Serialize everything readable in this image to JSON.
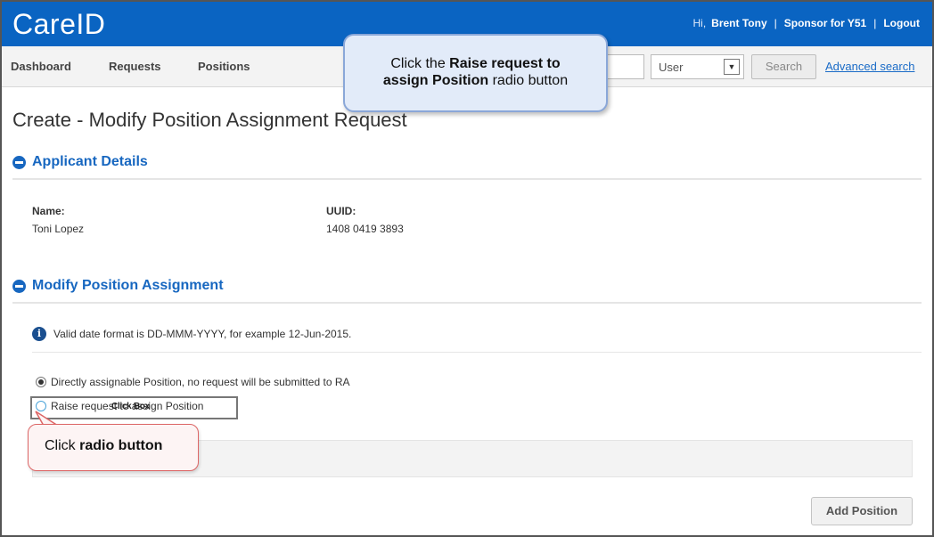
{
  "header": {
    "app_title": "CareID",
    "greeting": "Hi,",
    "user_name": "Brent Tony",
    "separator": "|",
    "role": "Sponsor for Y51",
    "logout_label": "Logout"
  },
  "nav": {
    "items": [
      {
        "label": "Dashboard"
      },
      {
        "label": "Requests"
      },
      {
        "label": "Positions"
      }
    ],
    "search_type_selected": "User",
    "search_button_label": "Search",
    "advanced_search_label": "Advanced search"
  },
  "callout_top": {
    "line1_pre": "Click the ",
    "line1_bold": "Raise request to",
    "line2_bold": "assign Position",
    "line2_post": " radio button"
  },
  "page": {
    "title": "Create - Modify Position Assignment Request"
  },
  "applicant_details": {
    "heading": "Applicant Details",
    "name_label": "Name:",
    "name_value": "Toni Lopez",
    "uuid_label": "UUID:",
    "uuid_value": "1408 0419 3893"
  },
  "modify_assignment": {
    "heading": "Modify Position Assignment",
    "info_text": "Valid date format is DD-MMM-YYYY, for example 12-Jun-2015.",
    "option_direct": "Directly assignable Position, no request will be submitted to RA",
    "option_raise": "Raise request to assign Position",
    "click_box_label": "Click Box",
    "add_button_label": "Add Position"
  },
  "callout_bottom": {
    "pre": "Click ",
    "bold": "radio button"
  },
  "colors": {
    "header_blue": "#0a64c2",
    "section_blue": "#1767c0",
    "callout_top_bg": "#e2ebf9",
    "callout_bottom_border": "#dd6666"
  }
}
